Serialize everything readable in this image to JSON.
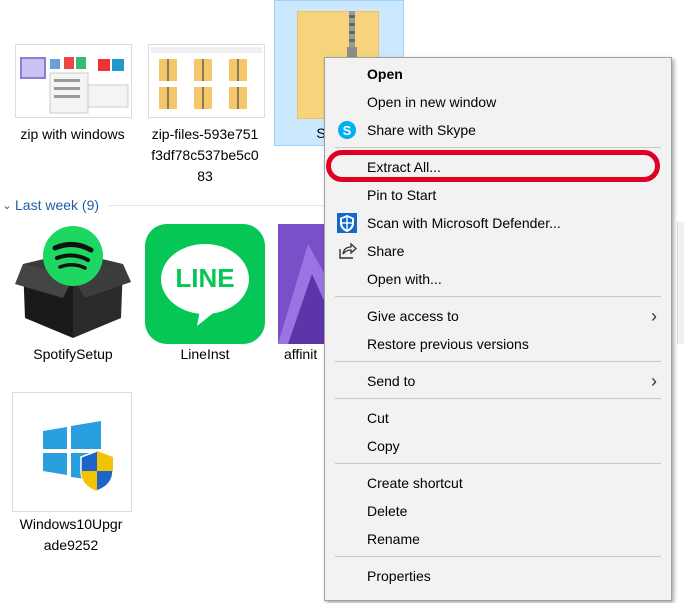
{
  "files_top": [
    {
      "name": "zip with windows"
    },
    {
      "name_lines": [
        "zip-files-593e751",
        "f3df78c537be5c0",
        "83"
      ]
    },
    {
      "name_partial": "S"
    }
  ],
  "group": {
    "label": "Last week (9)"
  },
  "files_week": [
    {
      "name": "SpotifySetup"
    },
    {
      "name": "LineInst",
      "icon_text": "LINE"
    },
    {
      "name": "affinit"
    },
    {
      "name_lines": [
        "Windows10Upgr",
        "ade9252"
      ]
    }
  ],
  "menu": {
    "items": [
      {
        "label": "Open"
      },
      {
        "label": "Open in new window"
      },
      {
        "label": "Share with Skype"
      },
      {
        "label": "Extract All..."
      },
      {
        "label": "Pin to Start"
      },
      {
        "label": "Scan with Microsoft Defender..."
      },
      {
        "label": "Share"
      },
      {
        "label": "Open with..."
      },
      {
        "label": "Give access to"
      },
      {
        "label": "Restore previous versions"
      },
      {
        "label": "Send to"
      },
      {
        "label": "Cut"
      },
      {
        "label": "Copy"
      },
      {
        "label": "Create shortcut"
      },
      {
        "label": "Delete"
      },
      {
        "label": "Rename"
      },
      {
        "label": "Properties"
      }
    ]
  },
  "colors": {
    "highlight_ring": "#e00024",
    "group_header": "#1e5fa8",
    "selection": "#cce8ff",
    "line_green": "#06c755"
  }
}
